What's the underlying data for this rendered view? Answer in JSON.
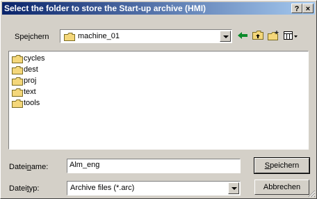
{
  "dialog": {
    "title": "Select the folder to store the Start-up archive (HMI)",
    "help_label": "?",
    "close_label": "×"
  },
  "save_in": {
    "label_pre": "Spe",
    "label_u": "i",
    "label_post": "chern",
    "value": "machine_01"
  },
  "folders": [
    {
      "name": "cycles"
    },
    {
      "name": "dest"
    },
    {
      "name": "proj"
    },
    {
      "name": "text"
    },
    {
      "name": "tools"
    }
  ],
  "filename": {
    "label_pre": "Datei",
    "label_u": "n",
    "label_post": "ame:",
    "value": "Alm_eng"
  },
  "filetype": {
    "label_pre": "Datei",
    "label_u": "t",
    "label_post": "yp:",
    "value": "Archive files (*.arc)"
  },
  "buttons": {
    "save_u": "S",
    "save_rest": "peichern",
    "cancel": "Abbrechen"
  },
  "colors": {
    "title_start": "#0a246a",
    "title_end": "#a6caf0",
    "folder": "#f4d77a",
    "back_arrow": "#0a8a2a"
  }
}
